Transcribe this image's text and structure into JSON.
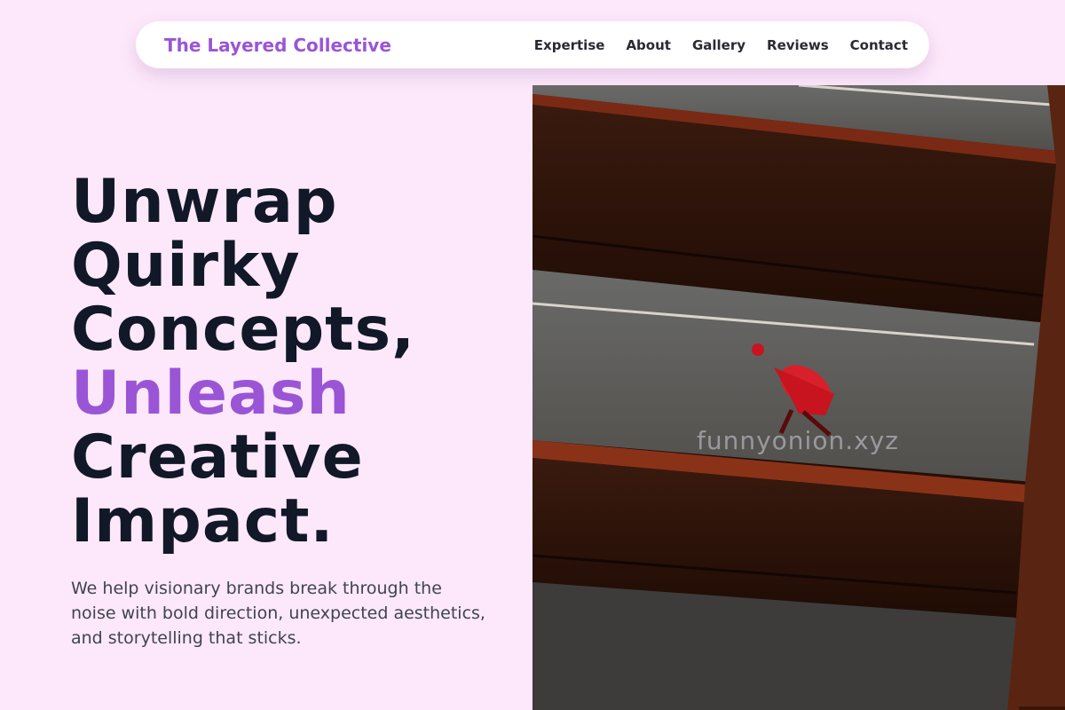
{
  "brand": "The Layered Collective",
  "nav": [
    "Expertise",
    "About",
    "Gallery",
    "Reviews",
    "Contact"
  ],
  "headline": {
    "line1": "Unwrap",
    "line2": "Quirky",
    "line3": "Concepts,",
    "line4": "Unleash",
    "line5": "Creative",
    "line6": "Impact."
  },
  "subtext": "We help visionary brands break through the noise with bold direction, unexpected aesthetics, and storytelling that sticks.",
  "photo": {
    "watermark": "funnyonion.xyz"
  },
  "colors": {
    "background": "#fde8fb",
    "accent": "#9a55d6",
    "headline": "#111827"
  }
}
